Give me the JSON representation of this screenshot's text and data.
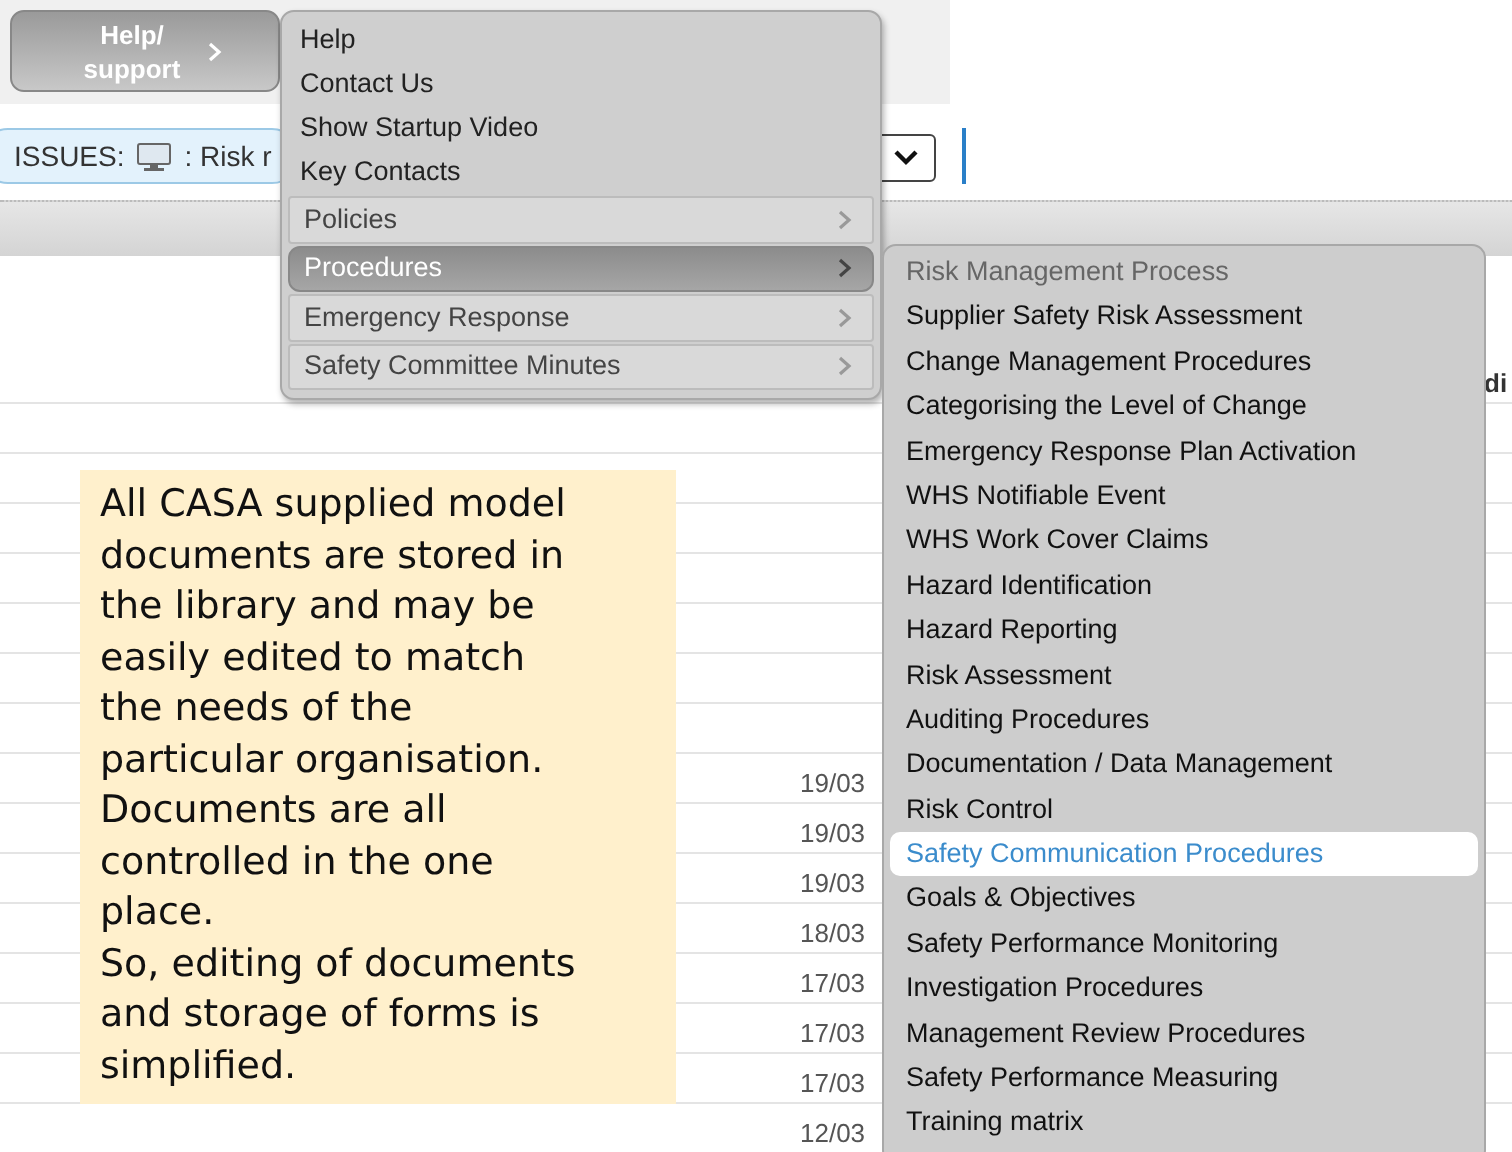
{
  "help_button": {
    "label": "Help/ support",
    "has_submenu": true
  },
  "issues": {
    "label": "ISSUES:",
    "value": ": Risk r"
  },
  "table": {
    "column_3": "di",
    "rows": [
      {
        "date": ""
      },
      {
        "date": ""
      },
      {
        "date": ""
      },
      {
        "date": ""
      },
      {
        "date": ""
      },
      {
        "date": ""
      },
      {
        "date": ""
      },
      {
        "date": "19/03"
      },
      {
        "date": "19/03"
      },
      {
        "date": "19/03"
      },
      {
        "date": "18/03"
      },
      {
        "date": "17/03"
      },
      {
        "date": "17/03"
      },
      {
        "date": "17/03"
      },
      {
        "date": "12/03"
      }
    ]
  },
  "note": "All CASA supplied model\ndocuments are stored in\nthe library and may be\neasily edited to match\nthe needs of the\nparticular organisation.\nDocuments are all\ncontrolled in the one\nplace.\nSo, editing of documents\nand storage of forms is\nsimplified.",
  "menu": [
    {
      "label": "Help",
      "kind": "link",
      "selected": false
    },
    {
      "label": "Contact Us",
      "kind": "link",
      "selected": false
    },
    {
      "label": "Show Startup Video",
      "kind": "link",
      "selected": false
    },
    {
      "label": "Key Contacts",
      "kind": "link",
      "selected": false
    },
    {
      "label": "Policies",
      "kind": "submenu",
      "selected": false
    },
    {
      "label": "Procedures",
      "kind": "submenu",
      "selected": true
    },
    {
      "label": "Emergency Response",
      "kind": "submenu",
      "selected": false
    },
    {
      "label": "Safety Committee Minutes",
      "kind": "submenu",
      "selected": false
    }
  ],
  "submenu": [
    {
      "label": "Risk Management Process",
      "disabled": true,
      "selected": false
    },
    {
      "label": "Supplier Safety Risk Assessment",
      "disabled": false,
      "selected": false
    },
    {
      "label": "Change Management Procedures",
      "disabled": false,
      "selected": false
    },
    {
      "label": "Categorising the Level of Change",
      "disabled": false,
      "selected": false
    },
    {
      "label": "Emergency Response Plan Activation",
      "disabled": false,
      "selected": false
    },
    {
      "label": "WHS Notifiable Event",
      "disabled": false,
      "selected": false
    },
    {
      "label": "WHS Work Cover Claims",
      "disabled": false,
      "selected": false
    },
    {
      "label": "Hazard Identification",
      "disabled": false,
      "selected": false
    },
    {
      "label": "Hazard Reporting",
      "disabled": false,
      "selected": false
    },
    {
      "label": "Risk Assessment",
      "disabled": false,
      "selected": false
    },
    {
      "label": "Auditing Procedures",
      "disabled": false,
      "selected": false
    },
    {
      "label": "Documentation / Data Management",
      "disabled": false,
      "selected": false
    },
    {
      "label": "Risk Control",
      "disabled": false,
      "selected": false
    },
    {
      "label": "Safety Communication Procedures",
      "disabled": false,
      "selected": true
    },
    {
      "label": "Goals & Objectives",
      "disabled": false,
      "selected": false
    },
    {
      "label": "Safety Performance Monitoring",
      "disabled": false,
      "selected": false
    },
    {
      "label": "Investigation Procedures",
      "disabled": false,
      "selected": false
    },
    {
      "label": "Management Review Procedures",
      "disabled": false,
      "selected": false
    },
    {
      "label": "Safety Performance Measuring",
      "disabled": false,
      "selected": false
    },
    {
      "label": "Training matrix",
      "disabled": false,
      "selected": false
    }
  ]
}
